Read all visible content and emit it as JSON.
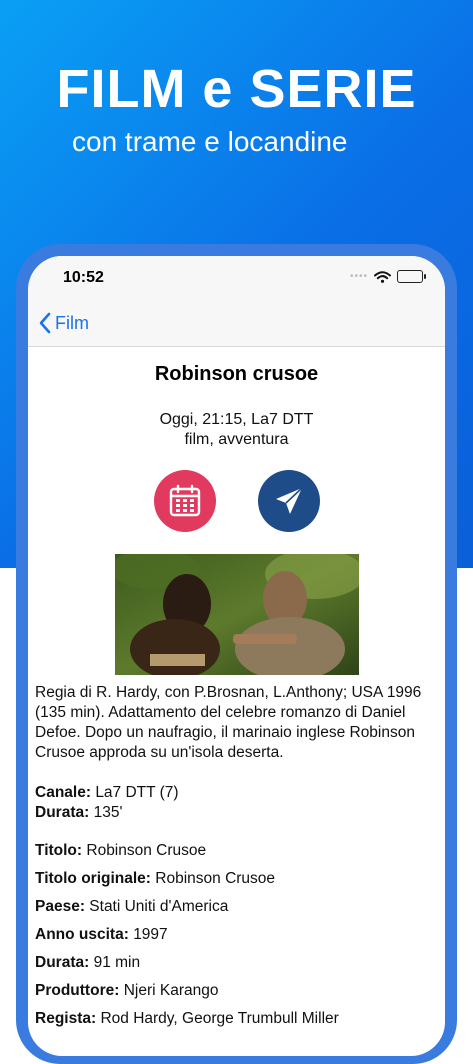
{
  "promo": {
    "title": "FILM e SERIE",
    "subtitle": "con trame e locandine"
  },
  "status_bar": {
    "time": "10:52"
  },
  "nav": {
    "back_label": "Film"
  },
  "movie": {
    "title": "Robinson crusoe",
    "schedule": "Oggi, 21:15, La7 DTT",
    "genres": "film, avventura",
    "description": "Regia di R. Hardy, con P.Brosnan, L.Anthony; USA 1996 (135 min). Adattamento del celebre romanzo di Daniel Defoe. Dopo un naufragio, il marinaio inglese Robinson Crusoe approda su un'isola deserta."
  },
  "broadcast": [
    {
      "label": "Canale:",
      "value": "La7 DTT (7)"
    },
    {
      "label": "Durata:",
      "value": "135'"
    }
  ],
  "details": [
    {
      "label": "Titolo:",
      "value": "Robinson Crusoe"
    },
    {
      "label": "Titolo originale:",
      "value": "Robinson Crusoe"
    },
    {
      "label": "Paese:",
      "value": "Stati Uniti d'America"
    },
    {
      "label": "Anno uscita:",
      "value": "1997"
    },
    {
      "label": "Durata:",
      "value": "91 min"
    },
    {
      "label": "Produttore:",
      "value": "Njeri Karango"
    },
    {
      "label": "Regista:",
      "value": "Rod Hardy, George Trumbull Miller"
    }
  ],
  "colors": {
    "accent": "#1a73e8",
    "calendar_button": "#e23a5e",
    "share_button": "#1e4c88",
    "promo_background": "#0a6ee6"
  },
  "icons": {
    "calendar": "calendar-icon",
    "share": "paper-plane-icon",
    "back": "chevron-left-icon"
  }
}
